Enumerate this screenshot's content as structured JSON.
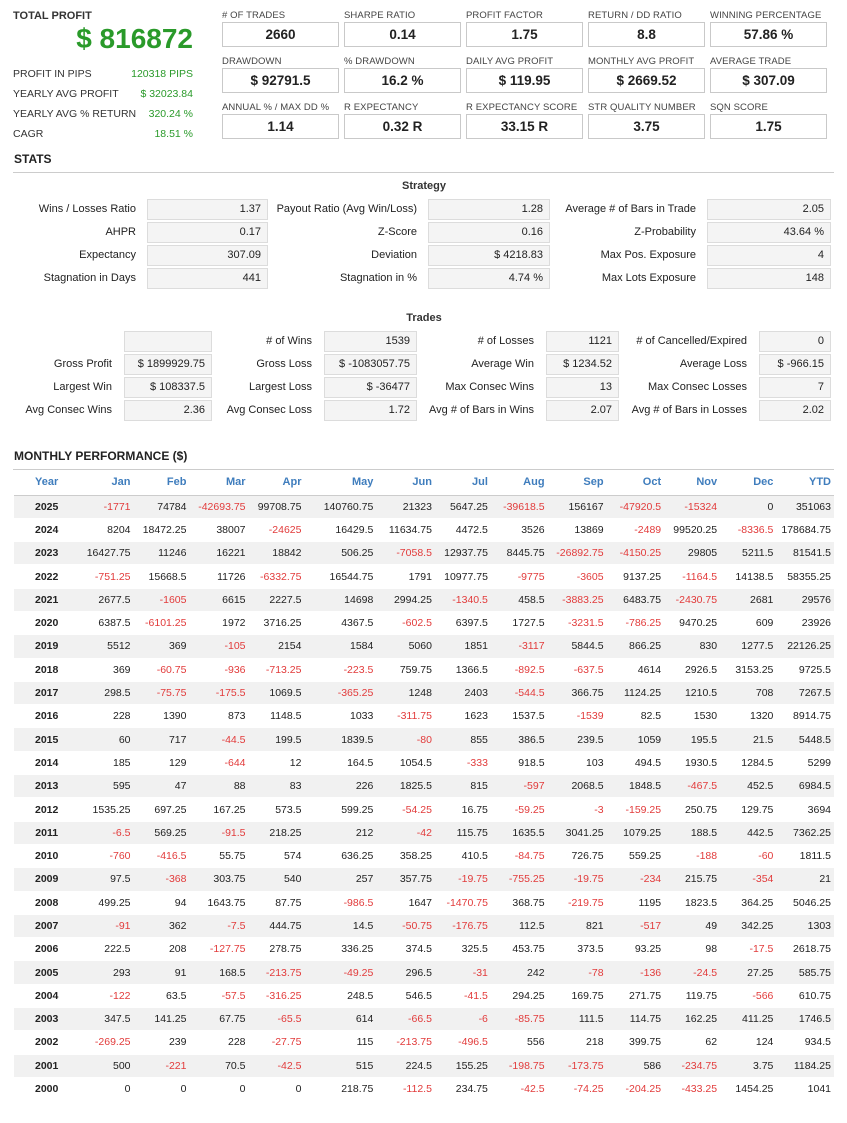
{
  "summary": {
    "total_profit_label": "TOTAL PROFIT",
    "total_profit_value": "$ 816872",
    "items": [
      {
        "label": "PROFIT IN PIPS",
        "value": "120318 PIPS"
      },
      {
        "label": "YEARLY AVG PROFIT",
        "value": "$ 32023.84"
      },
      {
        "label": "YEARLY AVG % RETURN",
        "value": "320.24 %"
      },
      {
        "label": "CAGR",
        "value": "18.51 %"
      }
    ]
  },
  "metrics": [
    [
      {
        "label": "# OF TRADES",
        "value": "2660"
      },
      {
        "label": "SHARPE RATIO",
        "value": "0.14"
      },
      {
        "label": "PROFIT FACTOR",
        "value": "1.75"
      },
      {
        "label": "RETURN / DD RATIO",
        "value": "8.8"
      },
      {
        "label": "WINNING PERCENTAGE",
        "value": "57.86 %"
      }
    ],
    [
      {
        "label": "DRAWDOWN",
        "value": "$ 92791.5"
      },
      {
        "label": "% DRAWDOWN",
        "value": "16.2 %"
      },
      {
        "label": "DAILY AVG PROFIT",
        "value": "$ 119.95"
      },
      {
        "label": "MONTHLY AVG PROFIT",
        "value": "$ 2669.52"
      },
      {
        "label": "AVERAGE TRADE",
        "value": "$ 307.09"
      }
    ],
    [
      {
        "label": "ANNUAL % / MAX DD %",
        "value": "1.14"
      },
      {
        "label": "R EXPECTANCY",
        "value": "0.32 R"
      },
      {
        "label": "R EXPECTANCY SCORE",
        "value": "33.15 R"
      },
      {
        "label": "STR QUALITY NUMBER",
        "value": "3.75"
      },
      {
        "label": "SQN SCORE",
        "value": "1.75"
      }
    ]
  ],
  "stats_title": "STATS",
  "strategy": {
    "title": "Strategy",
    "rows": [
      [
        {
          "label": "Wins / Losses Ratio",
          "value": "1.37"
        },
        {
          "label": "Payout Ratio (Avg Win/Loss)",
          "value": "1.28"
        },
        {
          "label": "Average # of Bars in Trade",
          "value": "2.05"
        }
      ],
      [
        {
          "label": "AHPR",
          "value": "0.17"
        },
        {
          "label": "Z-Score",
          "value": "0.16"
        },
        {
          "label": "Z-Probability",
          "value": "43.64 %"
        }
      ],
      [
        {
          "label": "Expectancy",
          "value": "307.09"
        },
        {
          "label": "Deviation",
          "value": "$ 4218.83"
        },
        {
          "label": "Max Pos. Exposure",
          "value": "4"
        }
      ],
      [
        {
          "label": "Stagnation in Days",
          "value": "441"
        },
        {
          "label": "Stagnation in %",
          "value": "4.74 %"
        },
        {
          "label": "Max Lots Exposure",
          "value": "148"
        }
      ]
    ]
  },
  "trades": {
    "title": "Trades",
    "rows": [
      [
        {
          "label": "",
          "value": ""
        },
        {
          "label": "# of Wins",
          "value": "1539"
        },
        {
          "label": "# of Losses",
          "value": "1121"
        },
        {
          "label": "# of Cancelled/Expired",
          "value": "0"
        }
      ],
      [
        {
          "label": "Gross Profit",
          "value": "$ 1899929.75"
        },
        {
          "label": "Gross Loss",
          "value": "$ -1083057.75"
        },
        {
          "label": "Average Win",
          "value": "$ 1234.52"
        },
        {
          "label": "Average Loss",
          "value": "$ -966.15"
        }
      ],
      [
        {
          "label": "Largest Win",
          "value": "$ 108337.5"
        },
        {
          "label": "Largest Loss",
          "value": "$ -36477"
        },
        {
          "label": "Max Consec Wins",
          "value": "13"
        },
        {
          "label": "Max Consec Losses",
          "value": "7"
        }
      ],
      [
        {
          "label": "Avg Consec Wins",
          "value": "2.36"
        },
        {
          "label": "Avg Consec Loss",
          "value": "1.72"
        },
        {
          "label": "Avg # of Bars in Wins",
          "value": "2.07"
        },
        {
          "label": "Avg # of Bars in Losses",
          "value": "2.02"
        }
      ]
    ]
  },
  "monthly": {
    "title": "MONTHLY PERFORMANCE ($)",
    "headers": [
      "Year",
      "Jan",
      "Feb",
      "Mar",
      "Apr",
      "May",
      "Jun",
      "Jul",
      "Aug",
      "Sep",
      "Oct",
      "Nov",
      "Dec",
      "YTD"
    ],
    "rows": [
      [
        "2025",
        "-1771",
        "74784",
        "-42693.75",
        "99708.75",
        "140760.75",
        "21323",
        "5647.25",
        "-39618.5",
        "156167",
        "-47920.5",
        "-15324",
        "0",
        "351063"
      ],
      [
        "2024",
        "8204",
        "18472.25",
        "38007",
        "-24625",
        "16429.5",
        "11634.75",
        "4472.5",
        "3526",
        "13869",
        "-2489",
        "99520.25",
        "-8336.5",
        "178684.75"
      ],
      [
        "2023",
        "16427.75",
        "11246",
        "16221",
        "18842",
        "506.25",
        "-7058.5",
        "12937.75",
        "8445.75",
        "-26892.75",
        "-4150.25",
        "29805",
        "5211.5",
        "81541.5"
      ],
      [
        "2022",
        "-751.25",
        "15668.5",
        "11726",
        "-6332.75",
        "16544.75",
        "1791",
        "10977.75",
        "-9775",
        "-3605",
        "9137.25",
        "-1164.5",
        "14138.5",
        "58355.25"
      ],
      [
        "2021",
        "2677.5",
        "-1605",
        "6615",
        "2227.5",
        "14698",
        "2994.25",
        "-1340.5",
        "458.5",
        "-3883.25",
        "6483.75",
        "-2430.75",
        "2681",
        "29576"
      ],
      [
        "2020",
        "6387.5",
        "-6101.25",
        "1972",
        "3716.25",
        "4367.5",
        "-602.5",
        "6397.5",
        "1727.5",
        "-3231.5",
        "-786.25",
        "9470.25",
        "609",
        "23926"
      ],
      [
        "2019",
        "5512",
        "369",
        "-105",
        "2154",
        "1584",
        "5060",
        "1851",
        "-3117",
        "5844.5",
        "866.25",
        "830",
        "1277.5",
        "22126.25"
      ],
      [
        "2018",
        "369",
        "-60.75",
        "-936",
        "-713.25",
        "-223.5",
        "759.75",
        "1366.5",
        "-892.5",
        "-637.5",
        "4614",
        "2926.5",
        "3153.25",
        "9725.5"
      ],
      [
        "2017",
        "298.5",
        "-75.75",
        "-175.5",
        "1069.5",
        "-365.25",
        "1248",
        "2403",
        "-544.5",
        "366.75",
        "1124.25",
        "1210.5",
        "708",
        "7267.5"
      ],
      [
        "2016",
        "228",
        "1390",
        "873",
        "1148.5",
        "1033",
        "-311.75",
        "1623",
        "1537.5",
        "-1539",
        "82.5",
        "1530",
        "1320",
        "8914.75"
      ],
      [
        "2015",
        "60",
        "717",
        "-44.5",
        "199.5",
        "1839.5",
        "-80",
        "855",
        "386.5",
        "239.5",
        "1059",
        "195.5",
        "21.5",
        "5448.5"
      ],
      [
        "2014",
        "185",
        "129",
        "-644",
        "12",
        "164.5",
        "1054.5",
        "-333",
        "918.5",
        "103",
        "494.5",
        "1930.5",
        "1284.5",
        "5299"
      ],
      [
        "2013",
        "595",
        "47",
        "88",
        "83",
        "226",
        "1825.5",
        "815",
        "-597",
        "2068.5",
        "1848.5",
        "-467.5",
        "452.5",
        "6984.5"
      ],
      [
        "2012",
        "1535.25",
        "697.25",
        "167.25",
        "573.5",
        "599.25",
        "-54.25",
        "16.75",
        "-59.25",
        "-3",
        "-159.25",
        "250.75",
        "129.75",
        "3694"
      ],
      [
        "2011",
        "-6.5",
        "569.25",
        "-91.5",
        "218.25",
        "212",
        "-42",
        "115.75",
        "1635.5",
        "3041.25",
        "1079.25",
        "188.5",
        "442.5",
        "7362.25"
      ],
      [
        "2010",
        "-760",
        "-416.5",
        "55.75",
        "574",
        "636.25",
        "358.25",
        "410.5",
        "-84.75",
        "726.75",
        "559.25",
        "-188",
        "-60",
        "1811.5"
      ],
      [
        "2009",
        "97.5",
        "-368",
        "303.75",
        "540",
        "257",
        "357.75",
        "-19.75",
        "-755.25",
        "-19.75",
        "-234",
        "215.75",
        "-354",
        "21"
      ],
      [
        "2008",
        "499.25",
        "94",
        "1643.75",
        "87.75",
        "-986.5",
        "1647",
        "-1470.75",
        "368.75",
        "-219.75",
        "1195",
        "1823.5",
        "364.25",
        "5046.25"
      ],
      [
        "2007",
        "-91",
        "362",
        "-7.5",
        "444.75",
        "14.5",
        "-50.75",
        "-176.75",
        "112.5",
        "821",
        "-517",
        "49",
        "342.25",
        "1303"
      ],
      [
        "2006",
        "222.5",
        "208",
        "-127.75",
        "278.75",
        "336.25",
        "374.5",
        "325.5",
        "453.75",
        "373.5",
        "93.25",
        "98",
        "-17.5",
        "2618.75"
      ],
      [
        "2005",
        "293",
        "91",
        "168.5",
        "-213.75",
        "-49.25",
        "296.5",
        "-31",
        "242",
        "-78",
        "-136",
        "-24.5",
        "27.25",
        "585.75"
      ],
      [
        "2004",
        "-122",
        "63.5",
        "-57.5",
        "-316.25",
        "248.5",
        "546.5",
        "-41.5",
        "294.25",
        "169.75",
        "271.75",
        "119.75",
        "-566",
        "610.75"
      ],
      [
        "2003",
        "347.5",
        "141.25",
        "67.75",
        "-65.5",
        "614",
        "-66.5",
        "-6",
        "-85.75",
        "111.5",
        "114.75",
        "162.25",
        "411.25",
        "1746.5"
      ],
      [
        "2002",
        "-269.25",
        "239",
        "228",
        "-27.75",
        "115",
        "-213.75",
        "-496.5",
        "556",
        "218",
        "399.75",
        "62",
        "124",
        "934.5"
      ],
      [
        "2001",
        "500",
        "-221",
        "70.5",
        "-42.5",
        "515",
        "224.5",
        "155.25",
        "-198.75",
        "-173.75",
        "586",
        "-234.75",
        "3.75",
        "1184.25"
      ],
      [
        "2000",
        "0",
        "0",
        "0",
        "0",
        "218.75",
        "-112.5",
        "234.75",
        "-42.5",
        "-74.25",
        "-204.25",
        "-433.25",
        "1454.25",
        "1041"
      ]
    ]
  }
}
